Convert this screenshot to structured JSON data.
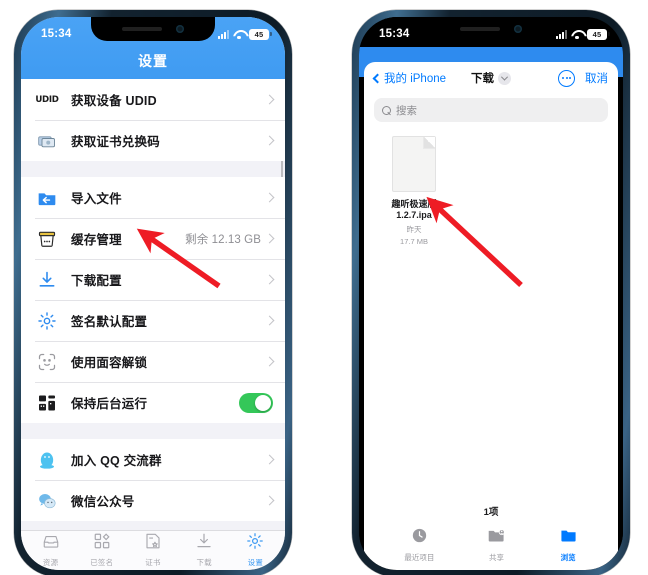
{
  "left_phone": {
    "status": {
      "time": "15:34",
      "battery": "45",
      "signal_icon": "cellular-signal-icon",
      "wifi_icon": "wifi-icon"
    },
    "navbar": {
      "title": "设置"
    },
    "sections": [
      {
        "rows": [
          {
            "icon": "udid-badge-icon",
            "label": "获取设备 UDID",
            "value": "",
            "accessory": "chevron"
          },
          {
            "icon": "voucher-icon",
            "label": "获取证书兑换码",
            "value": "",
            "accessory": "chevron"
          }
        ]
      },
      {
        "rows": [
          {
            "icon": "import-folder-icon",
            "label": "导入文件",
            "value": "",
            "accessory": "chevron"
          },
          {
            "icon": "cache-bucket-icon",
            "label": "缓存管理",
            "value": "剩余 12.13 GB",
            "accessory": "chevron"
          },
          {
            "icon": "download-icon",
            "label": "下载配置",
            "value": "",
            "accessory": "chevron"
          },
          {
            "icon": "gear-icon",
            "label": "签名默认配置",
            "value": "",
            "accessory": "chevron"
          },
          {
            "icon": "face-id-icon",
            "label": "使用面容解锁",
            "value": "",
            "accessory": "chevron"
          },
          {
            "icon": "background-run-icon",
            "label": "保持后台运行",
            "value": "",
            "accessory": "toggle-on"
          }
        ]
      },
      {
        "rows": [
          {
            "icon": "qq-penguin-icon",
            "label": "加入 QQ 交流群",
            "value": "",
            "accessory": "chevron"
          },
          {
            "icon": "wechat-icon",
            "label": "微信公众号",
            "value": "",
            "accessory": "chevron"
          }
        ]
      }
    ],
    "tabbar": [
      {
        "icon": "resources-tray-icon",
        "label": "资源",
        "active": false
      },
      {
        "icon": "signed-grid-icon",
        "label": "已签名",
        "active": false
      },
      {
        "icon": "certificate-icon",
        "label": "证书",
        "active": false
      },
      {
        "icon": "download-tab-icon",
        "label": "下载",
        "active": false
      },
      {
        "icon": "settings-gear-icon",
        "label": "设置",
        "active": true
      }
    ]
  },
  "right_phone": {
    "status": {
      "time": "15:34",
      "battery": "45",
      "signal_icon": "cellular-signal-icon",
      "wifi_icon": "wifi-icon"
    },
    "sheet_nav": {
      "back_label": "我的 iPhone",
      "title": "下载",
      "more_label": "more-options",
      "cancel_label": "取消"
    },
    "search": {
      "placeholder": "搜索",
      "value": ""
    },
    "files": [
      {
        "name": "趣听极速版 1.2.7.ipa",
        "date": "昨天",
        "size": "17.7 MB",
        "thumb": "document-icon"
      }
    ],
    "item_count": "1项",
    "tabs": [
      {
        "icon": "recents-clock-icon",
        "label": "最近项目",
        "active": false
      },
      {
        "icon": "shared-folder-icon",
        "label": "共享",
        "active": false
      },
      {
        "icon": "browse-folder-icon",
        "label": "浏览",
        "active": true
      }
    ]
  },
  "annotations": {
    "arrow_color": "#ee1c25",
    "arrows": [
      {
        "name": "arrow-to-import-file",
        "target": "导入文件"
      },
      {
        "name": "arrow-to-ipa-file",
        "target": "趣听极速版 1.2.7.ipa"
      }
    ]
  }
}
